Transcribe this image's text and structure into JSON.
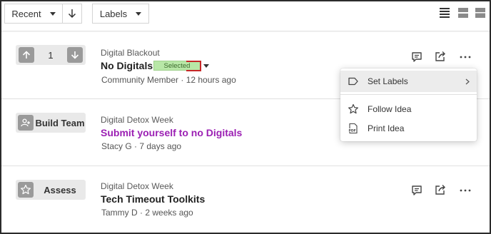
{
  "toolbar": {
    "sort_label": "Recent",
    "labels_label": "Labels"
  },
  "ideas": [
    {
      "campaign": "Digital Blackout",
      "title": "No Digitals",
      "badge": "Selected",
      "author": "Community Member",
      "time": "12 hours ago",
      "votes": "1"
    },
    {
      "campaign": "Digital Detox Week",
      "title": "Submit yourself to no Digitals",
      "stage": "Build Team",
      "author": "Stacy G",
      "time": "7 days ago"
    },
    {
      "campaign": "Digital Detox Week",
      "title": "Tech Timeout Toolkits",
      "stage": "Assess",
      "author": "Tammy D",
      "time": "2 weeks ago"
    }
  ],
  "menu": {
    "set_labels": "Set Labels",
    "follow": "Follow Idea",
    "print": "Print Idea"
  },
  "meta_separator": " · ",
  "colors": {
    "link": "#9b1fb3",
    "selected_badge": "#b8e7a7",
    "badge_outline": "#c62828"
  },
  "icons": {
    "view_list": "list-view-icon",
    "view_compact": "compact-view-icon",
    "view_cards": "card-view-icon"
  }
}
